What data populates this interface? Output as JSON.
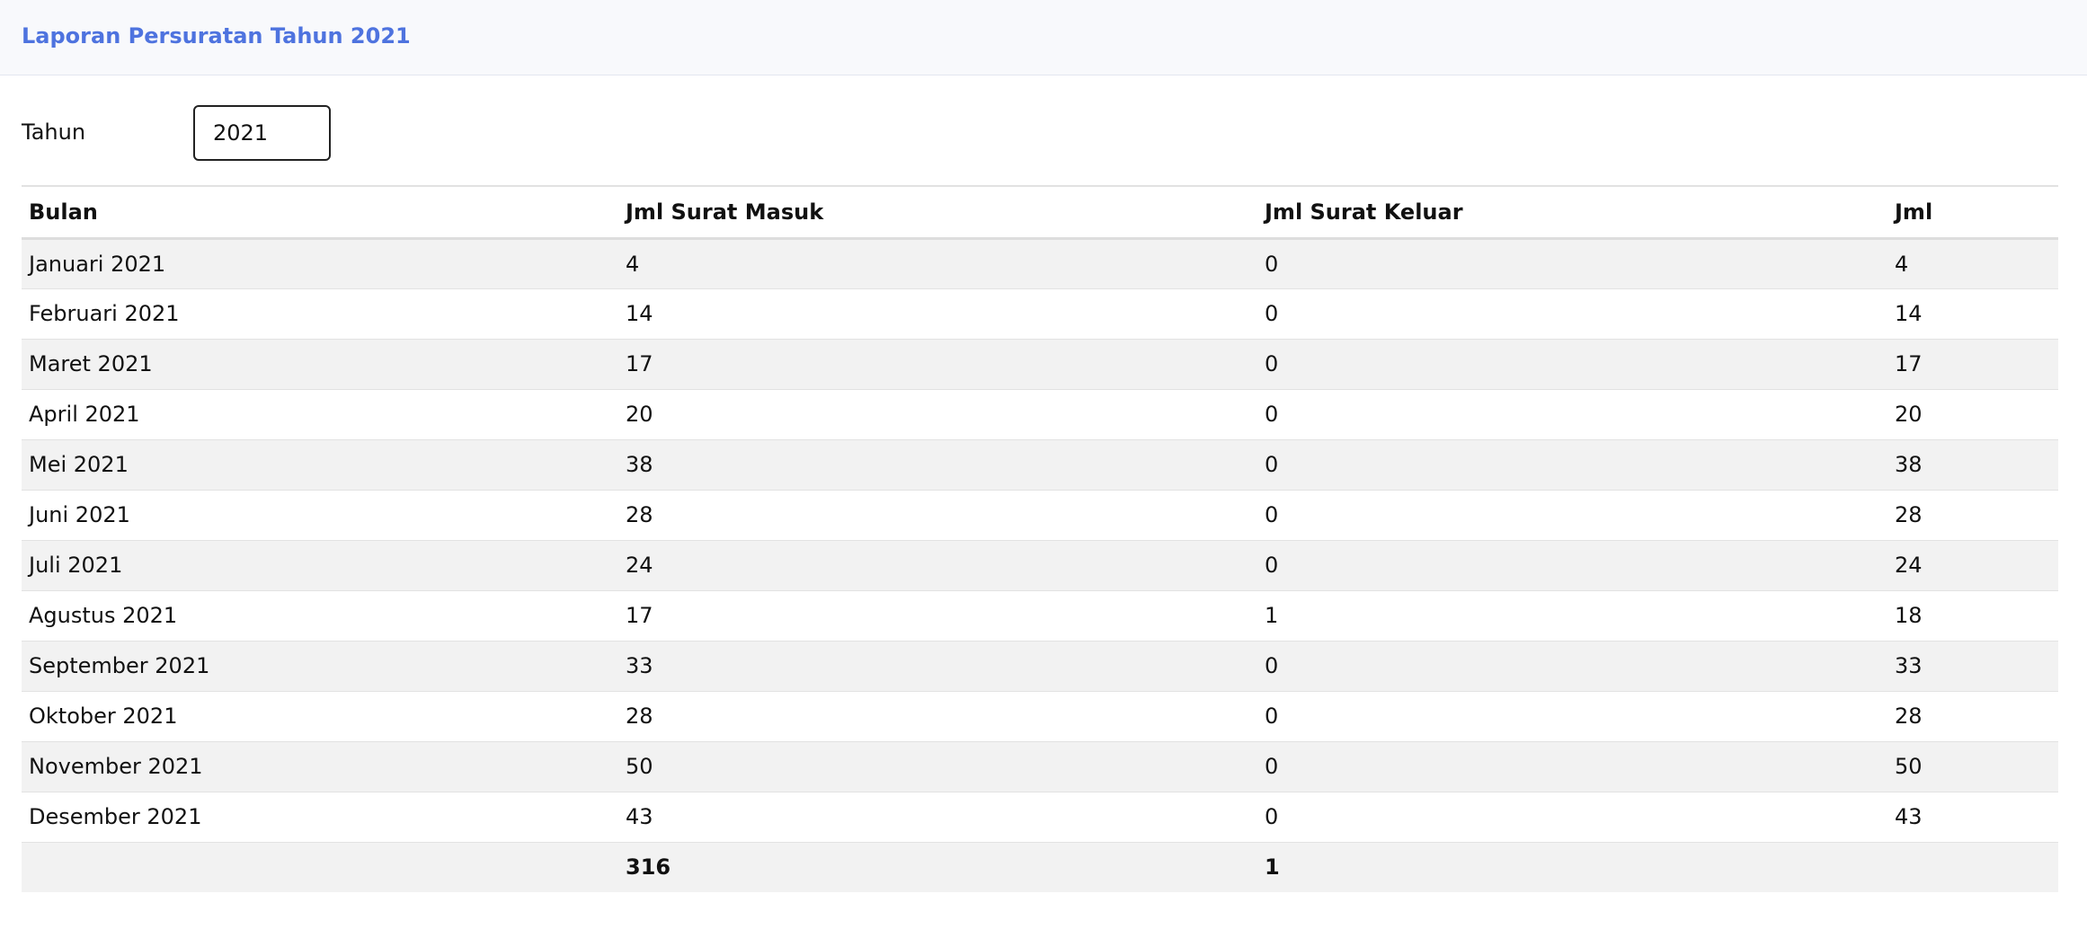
{
  "header": {
    "title": "Laporan Persuratan Tahun 2021"
  },
  "filter": {
    "label": "Tahun",
    "value": "2021"
  },
  "table": {
    "columns": [
      "Bulan",
      "Jml Surat Masuk",
      "Jml Surat Keluar",
      "Jml"
    ],
    "rows": [
      [
        "Januari 2021",
        "4",
        "0",
        "4"
      ],
      [
        "Februari 2021",
        "14",
        "0",
        "14"
      ],
      [
        "Maret 2021",
        "17",
        "0",
        "17"
      ],
      [
        "April 2021",
        "20",
        "0",
        "20"
      ],
      [
        "Mei 2021",
        "38",
        "0",
        "38"
      ],
      [
        "Juni 2021",
        "28",
        "0",
        "28"
      ],
      [
        "Juli 2021",
        "24",
        "0",
        "24"
      ],
      [
        "Agustus 2021",
        "17",
        "1",
        "18"
      ],
      [
        "September 2021",
        "33",
        "0",
        "33"
      ],
      [
        "Oktober 2021",
        "28",
        "0",
        "28"
      ],
      [
        "November 2021",
        "50",
        "0",
        "50"
      ],
      [
        "Desember 2021",
        "43",
        "0",
        "43"
      ]
    ],
    "totals": [
      "",
      "316",
      "1",
      ""
    ]
  },
  "colors": {
    "title": "#4e73df",
    "header_bg": "#f8f9fc",
    "stripe": "#f2f2f2"
  }
}
